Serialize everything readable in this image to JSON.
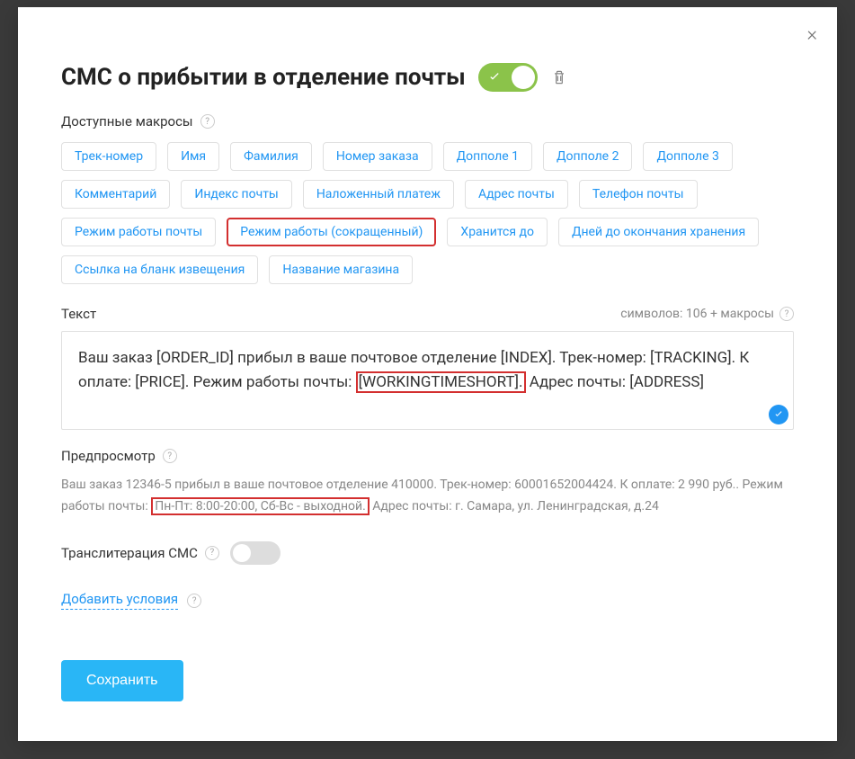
{
  "modal": {
    "title": "СМС о прибытии в отделение почты",
    "close_label": "×"
  },
  "macros_section": {
    "label": "Доступные макросы",
    "tags": [
      "Трек-номер",
      "Имя",
      "Фамилия",
      "Номер заказа",
      "Допполе 1",
      "Допполе 2",
      "Допполе 3",
      "Комментарий",
      "Индекс почты",
      "Наложенный платеж",
      "Адрес почты",
      "Телефон почты",
      "Режим работы почты",
      "Режим работы (сокращенный)",
      "Хранится до",
      "Дней до окончания хранения",
      "Ссылка на бланк извещения",
      "Название магазина"
    ],
    "highlighted_index": 13
  },
  "text_section": {
    "label": "Текст",
    "char_count": "символов: 106 + макросы",
    "content_before": "Ваш заказ [ORDER_ID] прибыл в ваше почтовое отделение [INDEX]. Трек-номер: [TRACKING]. К оплате: [PRICE]. Режим работы почты: ",
    "content_highlight": "[WORKINGTIMESHORT].",
    "content_after": " Адрес почты: [ADDRESS]"
  },
  "preview_section": {
    "label": "Предпросмотр",
    "text_before": "Ваш заказ 12346-5 прибыл в ваше почтовое отделение 410000. Трек-номер: 60001652004424. К оплате: 2 990 руб.. Режим работы почты: ",
    "text_highlight": "Пн-Пт: 8:00-20:00, Сб-Вс - выходной.",
    "text_after": " Адрес почты: г. Самара, ул. Ленинградская, д.24"
  },
  "transliteration": {
    "label": "Транслитерация СМС"
  },
  "conditions": {
    "add_label": "Добавить условия"
  },
  "buttons": {
    "save": "Сохранить"
  }
}
